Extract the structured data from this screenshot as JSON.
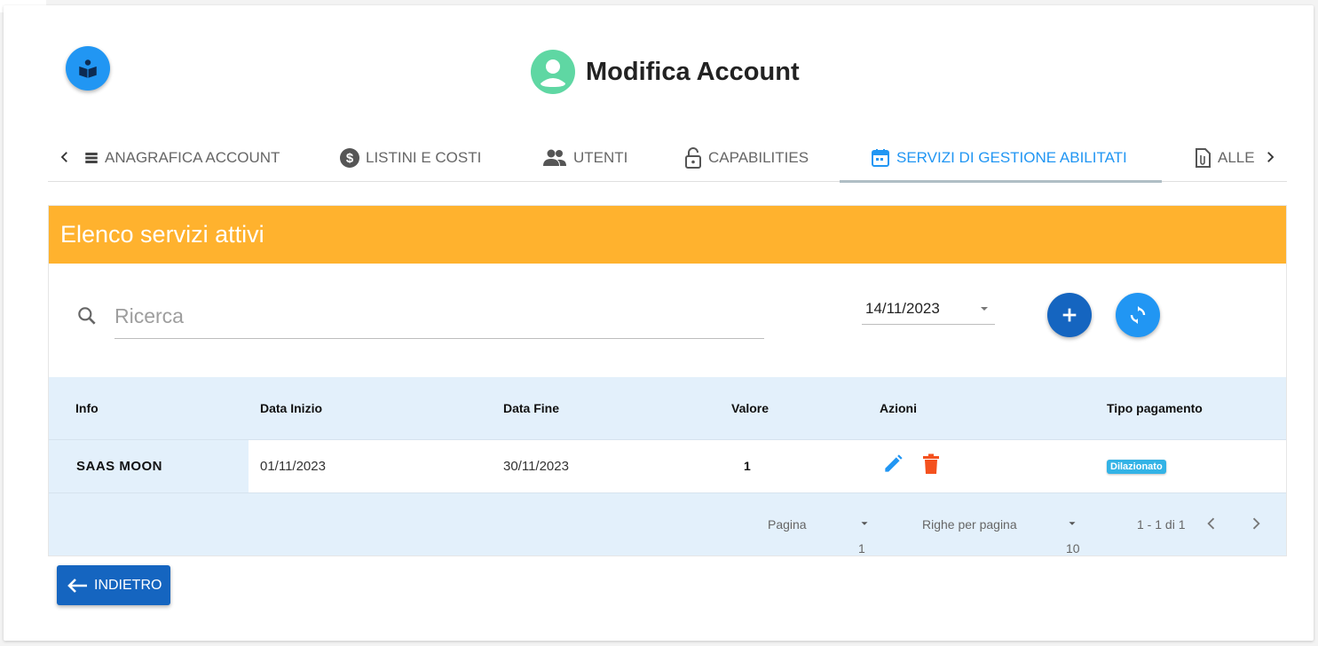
{
  "header": {
    "title": "Modifica Account",
    "logo_icon": "book-reader-icon",
    "avatar_icon": "user-avatar-icon"
  },
  "tabs": [
    {
      "label": "ANAGRAFICA ACCOUNT",
      "icon": "list-icon",
      "active": false
    },
    {
      "label": "LISTINI E COSTI",
      "icon": "dollar-circle-icon",
      "active": false
    },
    {
      "label": "UTENTI",
      "icon": "people-icon",
      "active": false
    },
    {
      "label": "CAPABILITIES",
      "icon": "lock-open-icon",
      "active": false
    },
    {
      "label": "SERVIZI DI GESTIONE ABILITATI",
      "icon": "calendar-icon",
      "active": true
    },
    {
      "label": "ALLE",
      "icon": "attachment-file-icon",
      "active": false
    }
  ],
  "section": {
    "title": "Elenco servizi attivi",
    "search_placeholder": "Ricerca",
    "date_value": "14/11/2023"
  },
  "table": {
    "columns": [
      "Info",
      "Data Inizio",
      "Data Fine",
      "Valore",
      "Azioni",
      "Tipo pagamento"
    ],
    "rows": [
      {
        "info": "SAAS MOON",
        "start": "01/11/2023",
        "end": "30/11/2023",
        "value": "1",
        "payment": "Dilazionato"
      }
    ]
  },
  "pagination": {
    "page_label": "Pagina",
    "page_value": "1",
    "rows_label": "Righe per pagina",
    "rows_value": "10",
    "range": "1 - 1 di 1"
  },
  "back_button": "INDIETRO",
  "colors": {
    "accent": "#2196f3",
    "banner": "#ffb22e",
    "primary_dark": "#1565c0",
    "delete": "#f4511e",
    "table_head": "#e3f0fb"
  }
}
